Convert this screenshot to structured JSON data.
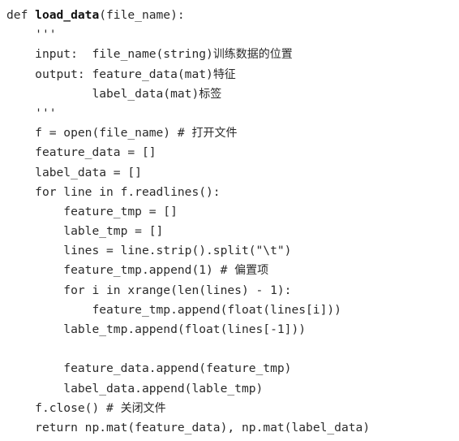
{
  "code_listing": {
    "lines": [
      {
        "indent": "",
        "parts": [
          {
            "t": "def "
          },
          {
            "t": "load_data",
            "style": "bold"
          },
          {
            "t": "(file_name):"
          }
        ]
      },
      {
        "indent": "    ",
        "parts": [
          {
            "t": "'''"
          }
        ]
      },
      {
        "indent": "    ",
        "parts": [
          {
            "t": "input:  file_name(string)"
          },
          {
            "t": "训练数据的位置",
            "style": "cjk"
          }
        ]
      },
      {
        "indent": "    ",
        "parts": [
          {
            "t": "output: feature_data(mat)"
          },
          {
            "t": "特征",
            "style": "cjk"
          }
        ]
      },
      {
        "indent": "            ",
        "parts": [
          {
            "t": "label_data(mat)"
          },
          {
            "t": "标签",
            "style": "cjk"
          }
        ]
      },
      {
        "indent": "    ",
        "parts": [
          {
            "t": "'''"
          }
        ]
      },
      {
        "indent": "    ",
        "parts": [
          {
            "t": "f = open(file_name) # "
          },
          {
            "t": "打开文件",
            "style": "cjk"
          }
        ]
      },
      {
        "indent": "    ",
        "parts": [
          {
            "t": "feature_data = []"
          }
        ]
      },
      {
        "indent": "    ",
        "parts": [
          {
            "t": "label_data = []"
          }
        ]
      },
      {
        "indent": "    ",
        "parts": [
          {
            "t": "for line in f.readlines():"
          }
        ]
      },
      {
        "indent": "        ",
        "parts": [
          {
            "t": "feature_tmp = []"
          }
        ]
      },
      {
        "indent": "        ",
        "parts": [
          {
            "t": "lable_tmp = []"
          }
        ]
      },
      {
        "indent": "        ",
        "parts": [
          {
            "t": "lines = line.strip().split(\"\\t\")"
          }
        ]
      },
      {
        "indent": "        ",
        "parts": [
          {
            "t": "feature_tmp.append(1) # "
          },
          {
            "t": "偏置项",
            "style": "cjk"
          }
        ]
      },
      {
        "indent": "        ",
        "parts": [
          {
            "t": "for i in xrange(len(lines) - 1):"
          }
        ]
      },
      {
        "indent": "            ",
        "parts": [
          {
            "t": "feature_tmp.append(float(lines[i]))"
          }
        ]
      },
      {
        "indent": "        ",
        "parts": [
          {
            "t": "lable_tmp.append(float(lines[-1]))"
          }
        ]
      },
      {
        "indent": "",
        "parts": []
      },
      {
        "indent": "        ",
        "parts": [
          {
            "t": "feature_data.append(feature_tmp)"
          }
        ]
      },
      {
        "indent": "        ",
        "parts": [
          {
            "t": "label_data.append(lable_tmp)"
          }
        ]
      },
      {
        "indent": "    ",
        "parts": [
          {
            "t": "f.close() # "
          },
          {
            "t": "关闭文件",
            "style": "cjk"
          }
        ]
      },
      {
        "indent": "    ",
        "parts": [
          {
            "t": "return np.mat(feature_data), np.mat(label_data)"
          }
        ]
      }
    ]
  }
}
